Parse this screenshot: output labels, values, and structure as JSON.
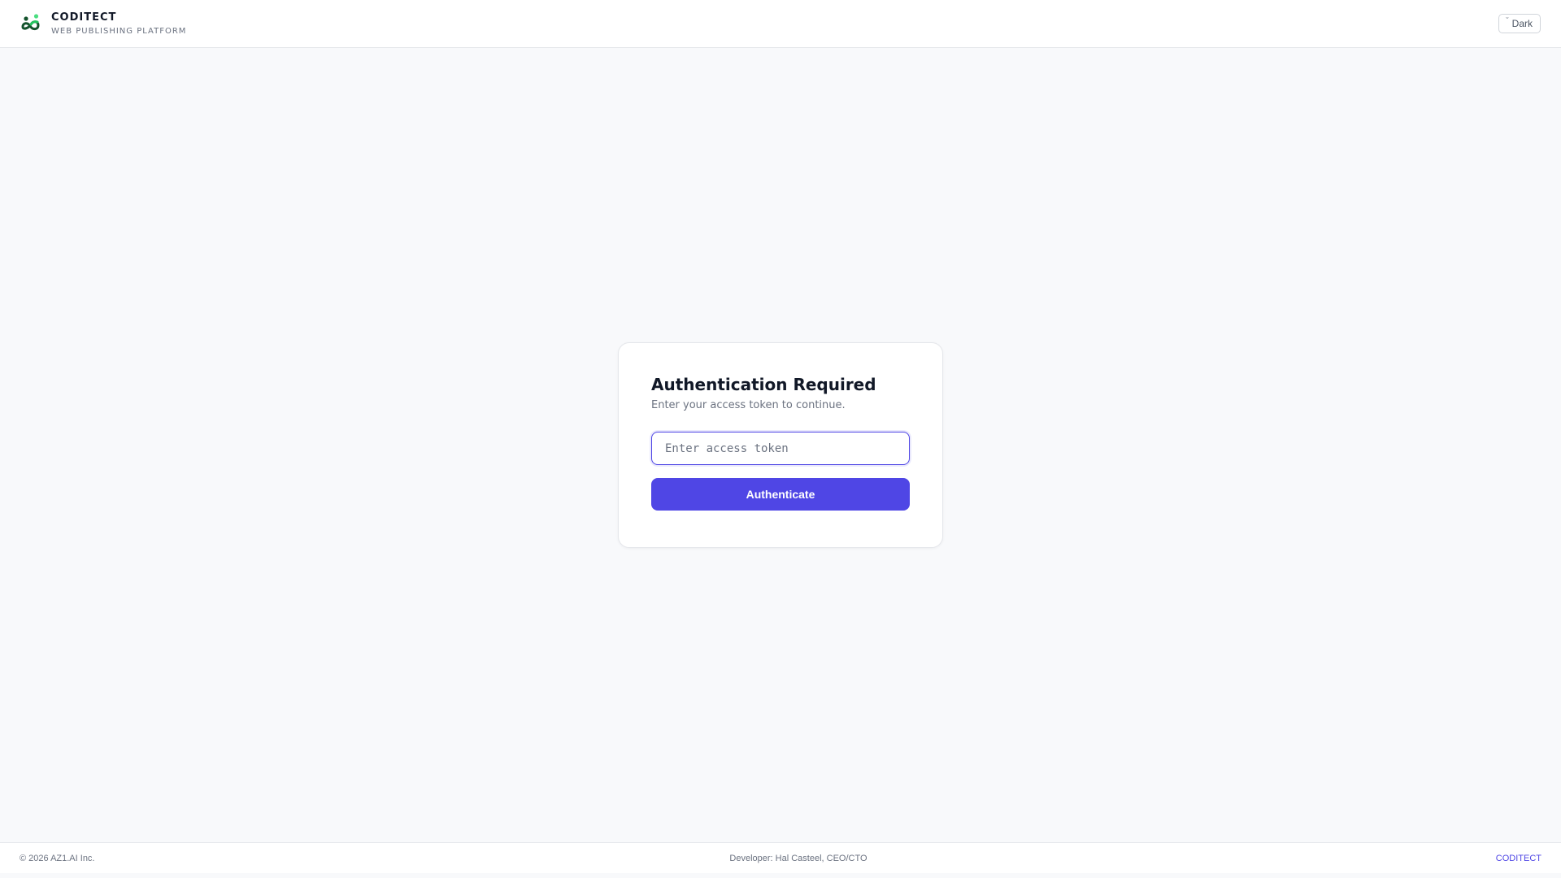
{
  "header": {
    "brand_name": "CODITECT",
    "tagline": "WEB PUBLISHING PLATFORM",
    "logo_icon": "coditect-logo-icon",
    "theme_toggle": {
      "icon": "moon-icon",
      "glyph": "˘",
      "label": "Dark"
    }
  },
  "auth": {
    "title": "Authentication Required",
    "subtitle": "Enter your access token to continue.",
    "token_input": {
      "value": "",
      "placeholder": "Enter access token"
    },
    "submit_label": "Authenticate"
  },
  "footer": {
    "copyright": "© 2026 AZ1.AI Inc.",
    "developer": "Developer: Hal Casteel, CEO/CTO",
    "link_label": "CODITECT"
  },
  "colors": {
    "accent": "#4f46e5",
    "background": "#f8f9fb",
    "logo_dark": "#14532d",
    "logo_light": "#4ade80"
  }
}
